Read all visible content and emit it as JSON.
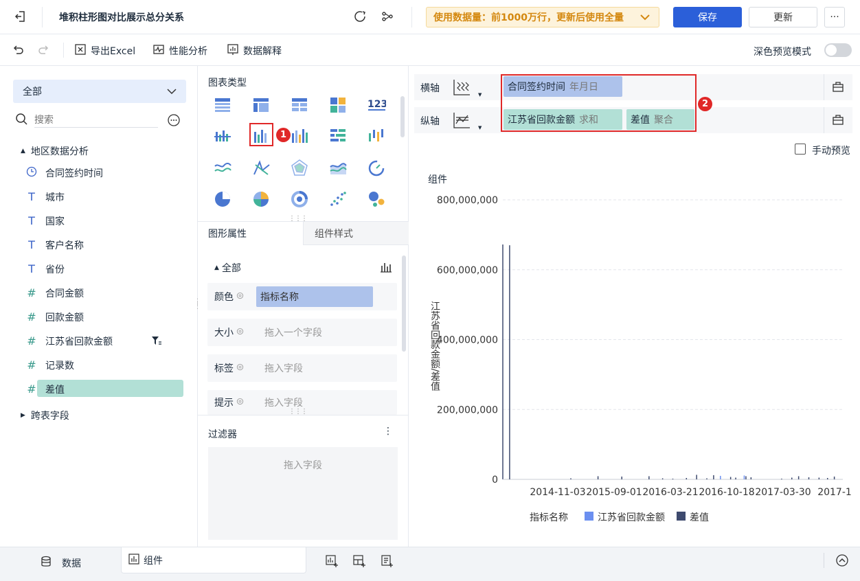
{
  "header": {
    "title": "堆积柱形图对比展示总分关系",
    "data_notice": "使用数据量：前1000万行，更新后使用全量",
    "save_label": "保存",
    "update_label": "更新",
    "more_label": "···"
  },
  "toolbar": {
    "export_excel": "导出Excel",
    "perf_analysis": "性能分析",
    "data_explain": "数据解释",
    "dark_mode_label": "深色预览模式"
  },
  "left_panel": {
    "dropdown_value": "全部",
    "search_placeholder": "搜索",
    "dataset_name": "地区数据分析",
    "fields": [
      {
        "type": "date",
        "icon": "clock-icon",
        "label": "合同签约时间"
      },
      {
        "type": "text",
        "icon": "T",
        "label": "城市"
      },
      {
        "type": "text",
        "icon": "T",
        "label": "国家"
      },
      {
        "type": "text",
        "icon": "T",
        "label": "客户名称"
      },
      {
        "type": "text",
        "icon": "T",
        "label": "省份"
      },
      {
        "type": "number",
        "icon": "#",
        "label": "合同金额"
      },
      {
        "type": "number",
        "icon": "#",
        "label": "回款金额"
      },
      {
        "type": "number",
        "icon": "#",
        "label": "江苏省回款金额"
      },
      {
        "type": "number",
        "icon": "#",
        "label": "记录数"
      },
      {
        "type": "number",
        "icon": "#",
        "label": "差值"
      }
    ],
    "cross_table": "跨表字段"
  },
  "chart_types": {
    "title": "图表类型"
  },
  "properties": {
    "tab_graph": "图形属性",
    "tab_style": "组件样式",
    "all_label": "全部",
    "rows": [
      {
        "label": "颜色",
        "value": "指标名称",
        "placeholder": ""
      },
      {
        "label": "大小",
        "value": "",
        "placeholder": "拖入一个字段"
      },
      {
        "label": "标签",
        "value": "",
        "placeholder": "拖入字段"
      },
      {
        "label": "提示",
        "value": "",
        "placeholder": "拖入字段"
      }
    ]
  },
  "filter": {
    "title": "过滤器",
    "placeholder": "拖入字段"
  },
  "axes": {
    "x_label": "横轴",
    "y_label": "纵轴",
    "x_field": "合同签约时间",
    "x_field_agg": "年月日",
    "y_field1": "江苏省回款金额",
    "y_field1_agg": "求和",
    "y_field2": "差值",
    "y_field2_agg": "聚合",
    "marker1": "1",
    "marker2": "2"
  },
  "manual_preview": "手动预览",
  "chart_data": {
    "type": "bar",
    "title": "组件",
    "ylabel": "江苏省回款金额/差值",
    "ylim": [
      0,
      800000000
    ],
    "yticks": [
      "800,000,000",
      "600,000,000",
      "400,000,000",
      "200,000,000",
      "0"
    ],
    "xticks": [
      "2014-11-03",
      "2015-09-01",
      "2016-03-21",
      "2016-10-18",
      "2017-03-30",
      "2017-1"
    ],
    "legend_title": "指标名称",
    "series": [
      {
        "name": "江苏省回款金额",
        "color": "#6b8ff0"
      },
      {
        "name": "差值",
        "color": "#3e4a6e"
      }
    ],
    "bars": [
      {
        "x": 0.02,
        "v": 670000000,
        "s": 1
      },
      {
        "x": 0.2,
        "v": 3000000,
        "s": 1
      },
      {
        "x": 0.28,
        "v": 9000000,
        "s": 1
      },
      {
        "x": 0.35,
        "v": 8000000,
        "s": 1
      },
      {
        "x": 0.43,
        "v": 9000000,
        "s": 1
      },
      {
        "x": 0.47,
        "v": 3000000,
        "s": 1
      },
      {
        "x": 0.5,
        "v": 2000000,
        "s": 1
      },
      {
        "x": 0.54,
        "v": 4000000,
        "s": 1
      },
      {
        "x": 0.57,
        "v": 13000000,
        "s": 1
      },
      {
        "x": 0.6,
        "v": 3000000,
        "s": 1
      },
      {
        "x": 0.62,
        "v": 12000000,
        "s": 1
      },
      {
        "x": 0.64,
        "v": 10000000,
        "s": 0
      },
      {
        "x": 0.67,
        "v": 7000000,
        "s": 1
      },
      {
        "x": 0.685,
        "v": 5000000,
        "s": 1
      },
      {
        "x": 0.71,
        "v": 11000000,
        "s": 0
      },
      {
        "x": 0.715,
        "v": 9000000,
        "s": 1
      },
      {
        "x": 0.73,
        "v": 6000000,
        "s": 1
      },
      {
        "x": 0.82,
        "v": 2000000,
        "s": 1
      },
      {
        "x": 0.85,
        "v": 5000000,
        "s": 1
      },
      {
        "x": 0.87,
        "v": 9000000,
        "s": 1
      },
      {
        "x": 0.9,
        "v": 6000000,
        "s": 1
      },
      {
        "x": 0.93,
        "v": 5000000,
        "s": 1
      },
      {
        "x": 0.955,
        "v": 4000000,
        "s": 1
      },
      {
        "x": 0.975,
        "v": 8000000,
        "s": 1
      }
    ]
  },
  "bottom": {
    "data_tab": "数据",
    "component_tab": "组件"
  }
}
